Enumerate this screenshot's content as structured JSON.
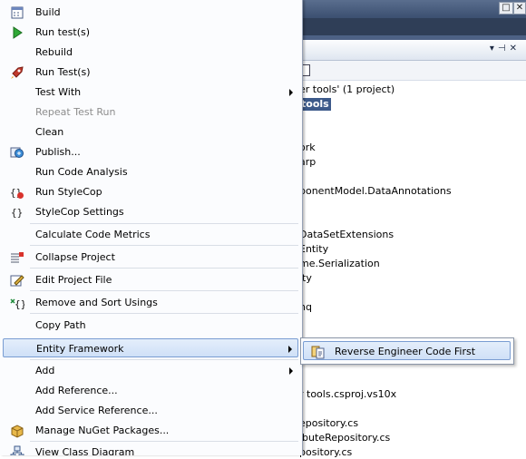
{
  "window": {
    "title_buttons": [
      "□",
      "✕"
    ],
    "panel_buttons": [
      "▾",
      "⊣",
      "✕"
    ]
  },
  "solution_explorer": {
    "lines": [
      "er tools' (1 project)",
      "tools",
      "ork",
      "arp",
      "ponentModel.DataAnnotations",
      "DataSetExtensions",
      "Entity",
      "me.Serialization",
      "ity",
      "nq",
      "r tools.csproj.vs10x",
      "epository.cs",
      "ibuteRepository.cs",
      "pository.cs"
    ]
  },
  "context_menu": {
    "items": [
      {
        "label": "Build",
        "icon": "build-icon"
      },
      {
        "label": "Run test(s)",
        "icon": "run-test-play-icon"
      },
      {
        "label": "Rebuild",
        "icon": ""
      },
      {
        "label": "Run Test(s)",
        "icon": "rocket-icon"
      },
      {
        "label": "Test With",
        "icon": ""
      },
      {
        "label": "Repeat Test Run",
        "icon": ""
      },
      {
        "label": "Clean",
        "icon": ""
      },
      {
        "label": "Publish...",
        "icon": "publish-icon"
      },
      {
        "label": "Run Code Analysis",
        "icon": ""
      },
      {
        "label": "Run StyleCop",
        "icon": "stylecop-run-icon"
      },
      {
        "label": "StyleCop Settings",
        "icon": "stylecop-settings-icon"
      },
      {
        "label": "Calculate Code Metrics",
        "icon": ""
      },
      {
        "label": "Collapse Project",
        "icon": "collapse-project-icon"
      },
      {
        "label": "Edit Project File",
        "icon": "edit-project-icon"
      },
      {
        "label": "Remove and Sort Usings",
        "icon": "sort-usings-icon"
      },
      {
        "label": "Copy Path",
        "icon": ""
      },
      {
        "label": "Entity Framework",
        "icon": ""
      },
      {
        "label": "Add",
        "icon": ""
      },
      {
        "label": "Add Reference...",
        "icon": ""
      },
      {
        "label": "Add Service Reference...",
        "icon": ""
      },
      {
        "label": "Manage NuGet Packages...",
        "icon": "nuget-icon"
      },
      {
        "label": "View Class Diagram",
        "icon": "class-diagram-icon"
      }
    ]
  },
  "submenu": {
    "items": [
      {
        "label": "Reverse Engineer Code First",
        "icon": "reverse-engineer-icon"
      }
    ]
  },
  "colors": {
    "menu_background": "#fbfcfe",
    "highlight_border": "#7a9dd2",
    "selection_background": "#3d5a8a"
  }
}
